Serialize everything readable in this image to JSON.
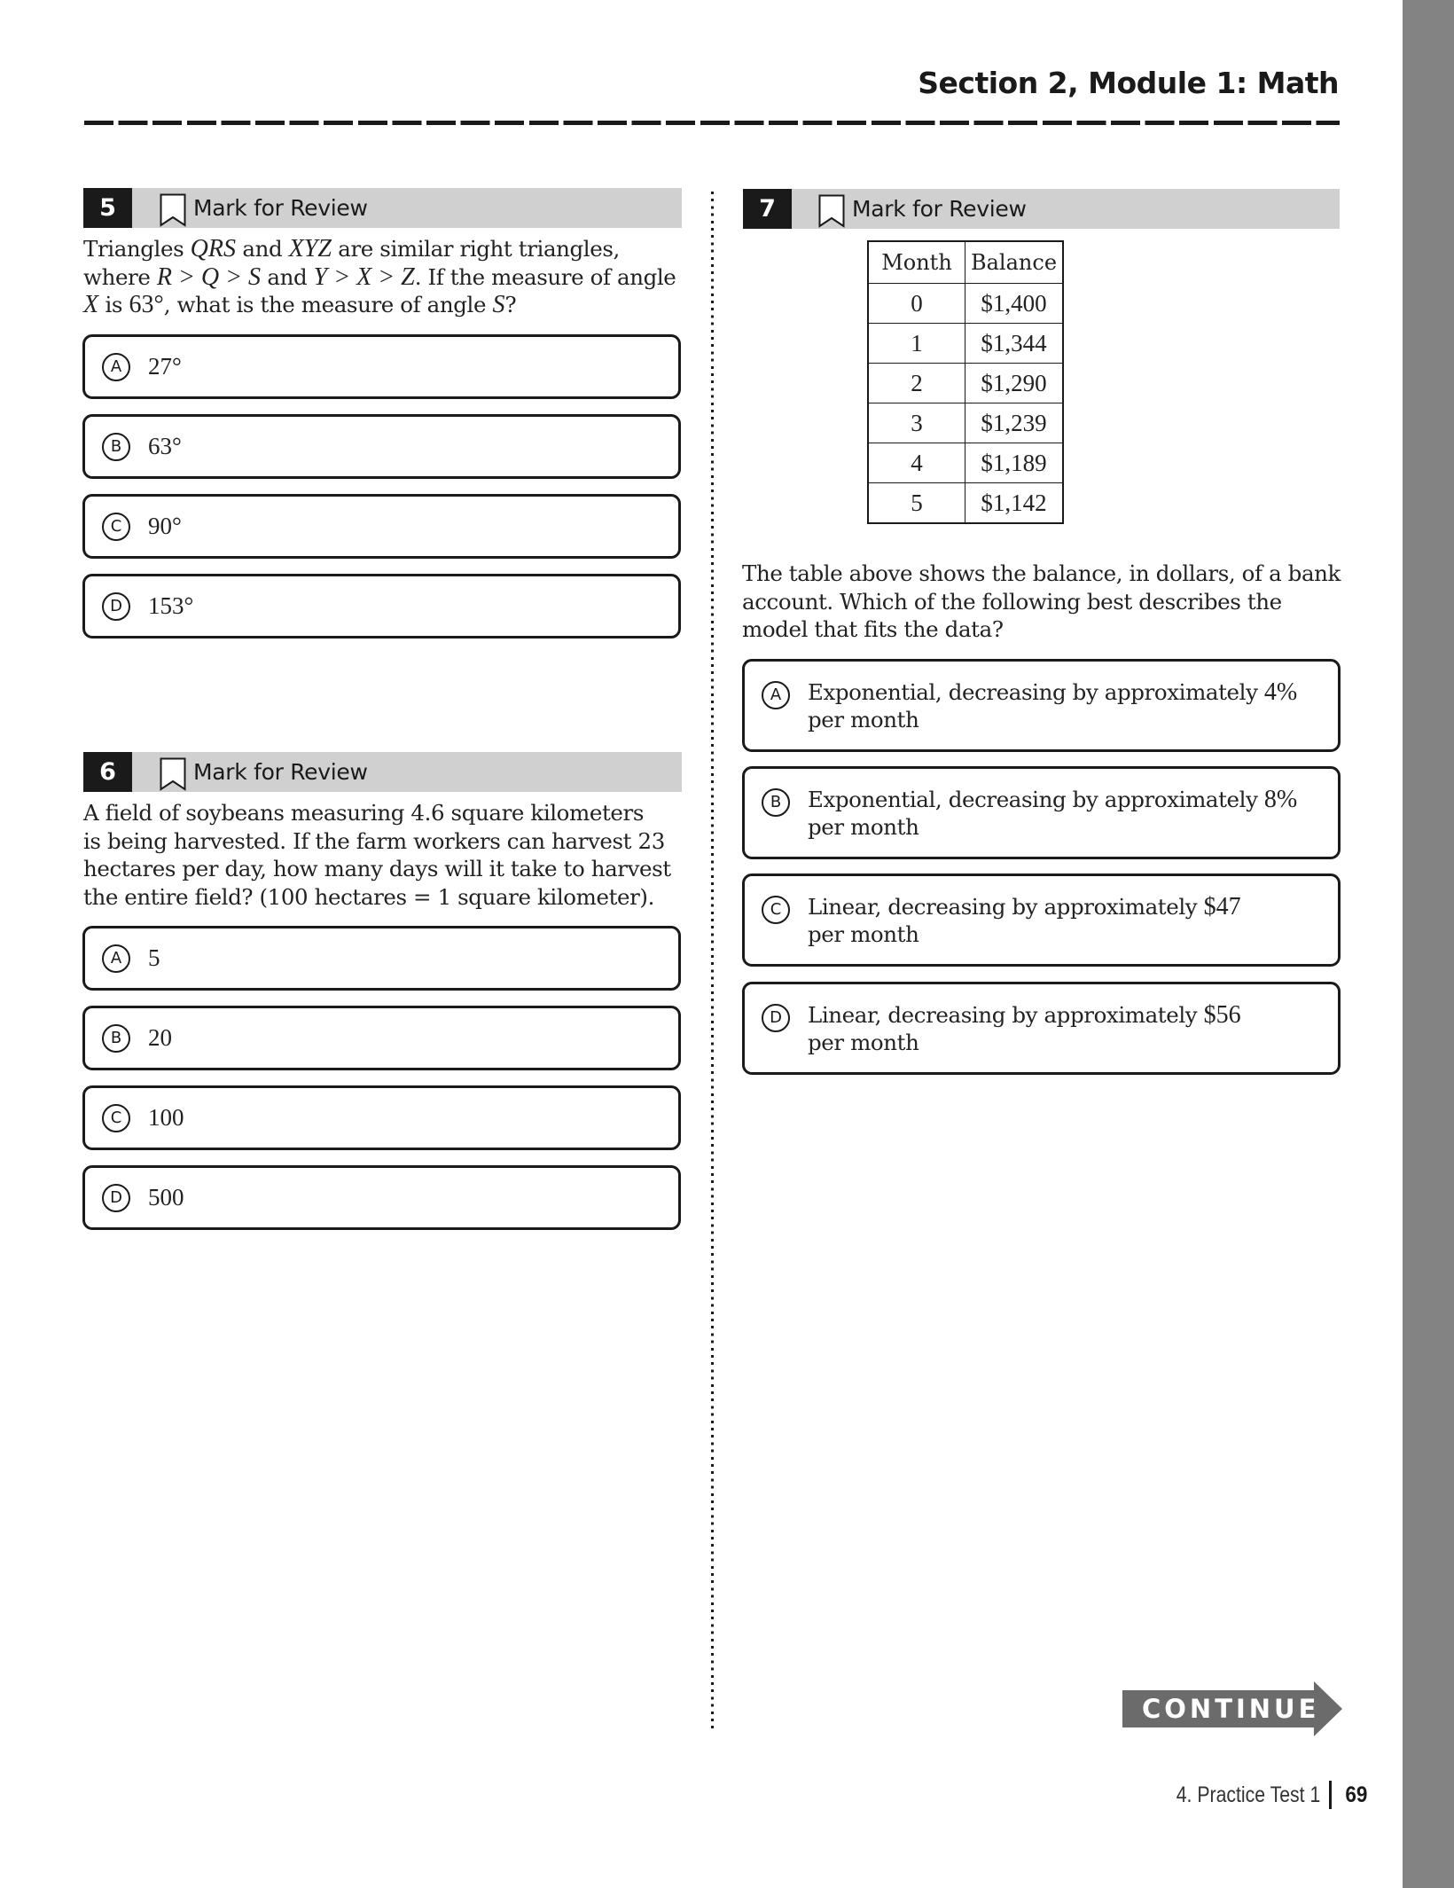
{
  "header": {
    "section_title": "Section 2, Module 1: Math"
  },
  "questions": [
    {
      "number": "5",
      "mark_label": "Mark for Review",
      "prompt": {
        "p1": "Triangles ",
        "v1": "QRS",
        "p2": " and ",
        "v2": "XYZ",
        "p3": " are similar right triangles, where ",
        "v3": "R > Q > S",
        "p4": " and ",
        "v4": "Y > X > Z",
        "p5": ". If the measure of angle ",
        "v5": "X",
        "p6": " is ",
        "v6": "63°",
        "p7": ", what is the measure of angle ",
        "v7": "S",
        "p8": "?"
      },
      "choices": [
        {
          "letter": "A",
          "text": "27°"
        },
        {
          "letter": "B",
          "text": "63°"
        },
        {
          "letter": "C",
          "text": "90°"
        },
        {
          "letter": "D",
          "text": "153°"
        }
      ]
    },
    {
      "number": "6",
      "mark_label": "Mark for Review",
      "prompt_lines": [
        "A field of soybeans measuring 4.6 square kilometers",
        "is being harvested. If the farm workers can harvest 23",
        "hectares per day, how many days will it take to harvest",
        "the entire field? (100 hectares = 1 square kilometer)."
      ],
      "choices": [
        {
          "letter": "A",
          "text": "5"
        },
        {
          "letter": "B",
          "text": "20"
        },
        {
          "letter": "C",
          "text": "100"
        },
        {
          "letter": "D",
          "text": "500"
        }
      ]
    },
    {
      "number": "7",
      "mark_label": "Mark for Review",
      "table": {
        "headers": [
          "Month",
          "Balance"
        ],
        "rows": [
          [
            "0",
            "$1,400"
          ],
          [
            "1",
            "$1,344"
          ],
          [
            "2",
            "$1,290"
          ],
          [
            "3",
            "$1,239"
          ],
          [
            "4",
            "$1,189"
          ],
          [
            "5",
            "$1,142"
          ]
        ]
      },
      "prompt_lines": [
        "The table above shows the balance, in dollars, of a bank",
        "account. Which of the following best describes the",
        "model that fits the data?"
      ],
      "choices": [
        {
          "letter": "A",
          "text": "Exponential, decreasing by approximately ",
          "value": "4%",
          "line2": "per month"
        },
        {
          "letter": "B",
          "text": "Exponential, decreasing by approximately ",
          "value": "8%",
          "line2": "per month"
        },
        {
          "letter": "C",
          "text": "Linear, decreasing by approximately ",
          "value": "$47",
          "line2": "per month"
        },
        {
          "letter": "D",
          "text": "Linear, decreasing by approximately ",
          "value": "$56",
          "line2": "per month"
        }
      ]
    }
  ],
  "continue_button": {
    "label": "CONTINUE",
    "color": "#6b6b6b"
  },
  "footer": {
    "chapter": "4.  Practice Test 1",
    "page": "69"
  },
  "colors": {
    "header_bar": "#d0d0d0",
    "number_box": "#1a1a1a",
    "side_tab": "#838383"
  }
}
